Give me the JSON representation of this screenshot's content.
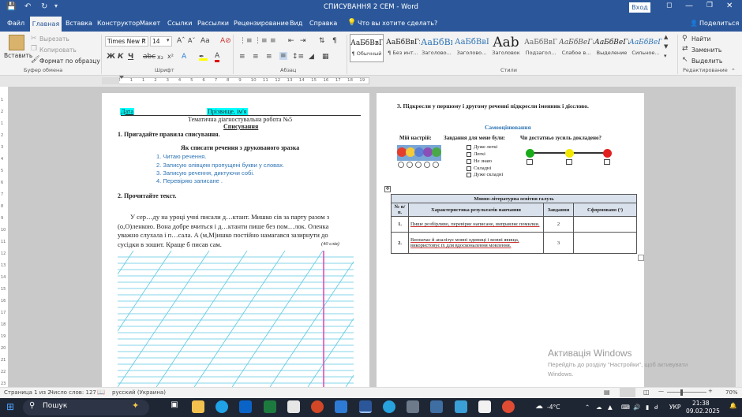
{
  "window": {
    "title": "СПИСУВАННЯ 2 СЕМ  -  Word",
    "signin": "Вход"
  },
  "tabs": [
    "Файл",
    "Главная",
    "Вставка",
    "Конструктор",
    "Макет",
    "Ссылки",
    "Рассылки",
    "Рецензирование",
    "Вид",
    "Справка"
  ],
  "tell_me": "Что вы хотите сделать?",
  "share": "Поделиться",
  "ribbon": {
    "clipboard": {
      "paste": "Вставить",
      "cut": "Вырезать",
      "copy": "Копировать",
      "format_painter": "Формат по образцу",
      "group": "Буфер обмена"
    },
    "font": {
      "name": "Times New R",
      "size": "14",
      "group": "Шрифт"
    },
    "paragraph": {
      "group": "Абзац"
    },
    "styles": {
      "group": "Стили",
      "items": [
        {
          "sample": "АаБбВвГг,",
          "name": "¶ Обычный"
        },
        {
          "sample": "АаБбВвГг,",
          "name": "¶ Без инт..."
        },
        {
          "sample": "АаБбВı",
          "name": "Заголово..."
        },
        {
          "sample": "АаБбВвГ",
          "name": "Заголово..."
        },
        {
          "sample": "Aab",
          "name": "Заголовок"
        },
        {
          "sample": "АаБбВвГ",
          "name": "Подзагол..."
        },
        {
          "sample": "АаБбВеГг,",
          "name": "Слабое в..."
        },
        {
          "sample": "АаБбВеГг,",
          "name": "Выделение"
        },
        {
          "sample": "АаБбВеГг,",
          "name": "Сильное..."
        }
      ]
    },
    "editing": {
      "find": "Найти",
      "replace": "Заменить",
      "select": "Выделить",
      "group": "Редактирование"
    }
  },
  "ruler_ticks": [
    "1",
    "2",
    "1",
    "1",
    "2",
    "3",
    "4",
    "5",
    "6",
    "7",
    "8",
    "9",
    "10",
    "11",
    "12",
    "13",
    "14",
    "15",
    "16",
    "17",
    "18",
    "19"
  ],
  "vruler_ticks": [
    "1",
    "2",
    "1",
    "2",
    "3",
    "4",
    "5",
    "6",
    "7",
    "8",
    "9",
    "10",
    "11",
    "12",
    "13",
    "14",
    "15",
    "16",
    "17",
    "18",
    "19",
    "20",
    "21",
    "22",
    "23"
  ],
  "page1": {
    "date_label": "Дата",
    "name_label": "Прізвище, ім'я",
    "work_title": "Тематична діагностувальна робота №5",
    "work_subtitle": "Списування",
    "task1": "1.    Пригадайте правила списування.",
    "rules_title": "Як списати речення з друкованого зразка",
    "rules": [
      "1.   Читаю речення.",
      "2.   Записую олівцем пропущені букви у словах.",
      "3.   Записую речення, диктуючи собі.",
      "4.   Перевіряю записане ."
    ],
    "task2": "2.    Прочитайте текст.",
    "text_lines": [
      "У сер…ду на уроці учні писали д…ктант. Мишко сів за парту разом з",
      "(о,О)ленкою. Вона добре вчиться і д…ктанти пише без пом…лок. Оленка",
      "уважно слухала і п…сала. А (м,М)ишко постійно намагався зазирнути до",
      "сусідки в зошит. Краще б писав сам."
    ],
    "word_count": "(40 слів)"
  },
  "page2": {
    "task3": "3.    Підкресли у першому і другому реченні підкресли іменник і дієслово.",
    "self_eval": "Самооцінювання",
    "mood": "Мій настрій:",
    "tasks_were": "Завдання для мене були:",
    "effort": "Чи достатньо зусиль докладено?",
    "options": [
      "Дуже легкі",
      "Легкі",
      "Не знаю",
      "Складні",
      "Дуже складні"
    ],
    "table": {
      "title": "Мовно-літературна освітня галузь",
      "headers": [
        "№ п/п.",
        "Характеристика результатів навчання",
        "Завдання",
        "Сформовано (ᵛ)"
      ],
      "rows": [
        {
          "num": "1.",
          "text": "Пише розбірливо, перевіряє написане, виправляє помилки.",
          "task": "2",
          "formed": ""
        },
        {
          "num": "2.",
          "text": "Визначає й аналізує мовні одиниці і мовні явища, використовує їх для вдосконалення мовлення.",
          "task": "3",
          "formed": ""
        }
      ]
    },
    "traffic_colors": [
      "#1aab1a",
      "#f2e800",
      "#e32020"
    ]
  },
  "status": {
    "page": "Страница 1 из 2",
    "words": "Число слов: 127",
    "lang": "русский (Украина)",
    "zoom": "70%"
  },
  "watermark": {
    "line1": "Активація Windows",
    "line2": "Перейдіть до розділу \"Настройки\", щоб активувати",
    "line3": "Windows."
  },
  "taskbar": {
    "search": "Пошук",
    "weather": "-4°C",
    "lang": "УКР",
    "time": "21:38",
    "date": "09.02.2025"
  },
  "colors": {
    "accent": "#2b579a",
    "highlight": "#00ffff",
    "list_blue": "#2e74b5",
    "pink_margin": "#e63fb3"
  }
}
